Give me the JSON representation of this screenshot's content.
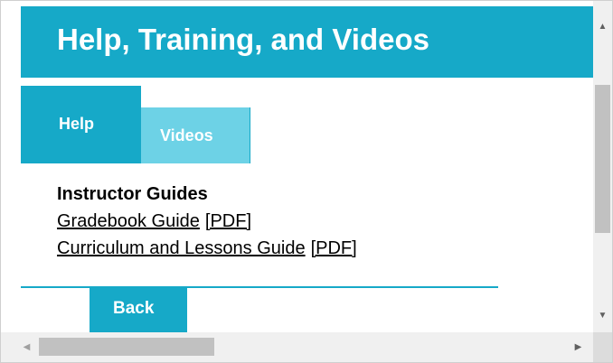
{
  "header": {
    "title": "Help, Training, and Videos"
  },
  "tabs": [
    {
      "label": "Help",
      "active": true
    },
    {
      "label": "Videos",
      "active": false
    }
  ],
  "guides": {
    "heading": "Instructor Guides",
    "items": [
      {
        "label": "Gradebook Guide",
        "pdf_label": "[PDF]"
      },
      {
        "label": "Curriculum and Lessons Guide",
        "pdf_label": "[PDF]"
      }
    ]
  },
  "back_button": {
    "label": "Back"
  },
  "scrollbars": {
    "icons": {
      "up": "▲",
      "down": "▼",
      "left": "◀",
      "right": "▶"
    }
  },
  "colors": {
    "primary": "#16a9c8",
    "tab_inactive": "#6dd2e6",
    "scrollbar_track": "#f0f0f0",
    "scrollbar_thumb": "#c1c1c1"
  }
}
